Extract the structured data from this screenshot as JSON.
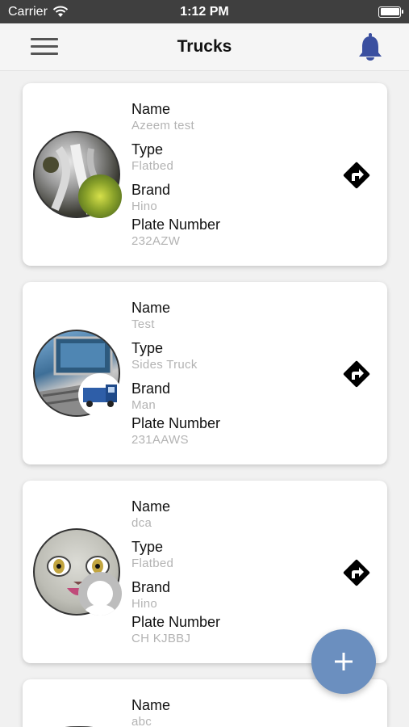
{
  "status_bar": {
    "carrier": "Carrier",
    "time": "1:12 PM"
  },
  "header": {
    "title": "Trucks"
  },
  "colors": {
    "accent": "#6b8fbf",
    "bell": "#3a4fa0",
    "label_text": "#111111",
    "value_text": "#b3b3b3"
  },
  "icons": {
    "menu": "hamburger-icon",
    "notifications": "bell-icon",
    "directions": "directions-icon",
    "add": "plus-icon"
  },
  "trucks": [
    {
      "name_label": "Name",
      "name": "Azeem test",
      "type_label": "Type",
      "type": "Flatbed",
      "brand_label": "Brand",
      "brand": "Hino",
      "plate_label": "Plate Number",
      "plate": "232AZW"
    },
    {
      "name_label": "Name",
      "name": "Test",
      "type_label": "Type",
      "type": "Sides Truck",
      "brand_label": "Brand",
      "brand": "Man",
      "plate_label": "Plate Number",
      "plate": "231AAWS"
    },
    {
      "name_label": "Name",
      "name": "dca",
      "type_label": "Type",
      "type": "Flatbed",
      "brand_label": "Brand",
      "brand": "Hino",
      "plate_label": "Plate Number",
      "plate": "CH KJBBJ"
    },
    {
      "name_label": "Name",
      "name": "abc"
    }
  ]
}
